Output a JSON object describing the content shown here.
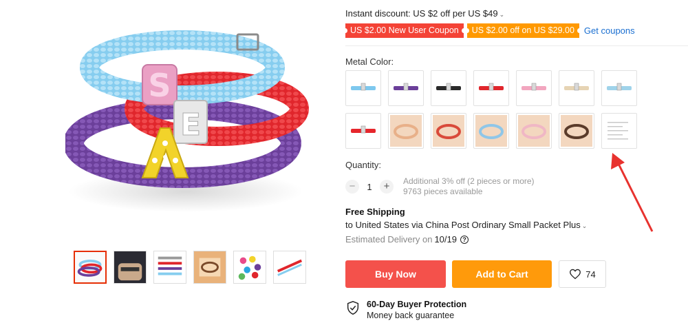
{
  "discount": {
    "text": "Instant discount: US $2 off per US $49",
    "chevron": "⌄"
  },
  "coupons": [
    {
      "label": "US $2.00 New User Coupon",
      "color": "#f44336"
    },
    {
      "label": "US $2.00 off on US $29.00",
      "color": "#ff9900"
    }
  ],
  "get_coupons_link": "Get coupons",
  "metal_color": {
    "label": "Metal Color:",
    "swatches": [
      {
        "name": "sky-blue",
        "color": "#7ec8ee"
      },
      {
        "name": "purple",
        "color": "#6b3f9a"
      },
      {
        "name": "black",
        "color": "#2a2a2a"
      },
      {
        "name": "red",
        "color": "#e0262c"
      },
      {
        "name": "pink",
        "color": "#f2a6bf"
      },
      {
        "name": "beige",
        "color": "#e6d4b4"
      },
      {
        "name": "light-blue",
        "color": "#9fd3ea"
      },
      {
        "name": "red-2",
        "color": "#e6262c"
      },
      {
        "name": "cream-sliders",
        "color": "#e8b089"
      },
      {
        "name": "red-sliders",
        "color": "#d94a3a"
      },
      {
        "name": "blue-sliders",
        "color": "#8fc6e8"
      },
      {
        "name": "pink-sliders",
        "color": "#f0b7c5"
      },
      {
        "name": "dark-sliders",
        "color": "#5a3b2a"
      },
      {
        "name": "size-chart",
        "color": "#f4f4f4"
      }
    ]
  },
  "quantity": {
    "label": "Quantity:",
    "value": "1",
    "minus": "−",
    "plus": "+",
    "bulk_note": "Additional 3% off (2 pieces or more)",
    "available": "9763 pieces available"
  },
  "shipping": {
    "title": "Free Shipping",
    "line": "to United States via China Post Ordinary Small Packet Plus",
    "chevron": "⌄",
    "estimated_label": "Estimated Delivery on",
    "date": "10/19",
    "help_icon": "?"
  },
  "actions": {
    "buy_now": "Buy Now",
    "add_to_cart": "Add to Cart",
    "wishlist_count": "74"
  },
  "protection": {
    "title": "60-Day Buyer Protection",
    "subtitle": "Money back guarantee"
  },
  "colors": {
    "accent_red": "#f4514b",
    "accent_orange": "#ff9a0b",
    "link_blue": "#1a6fd1",
    "arrow_red": "#e8322e"
  }
}
